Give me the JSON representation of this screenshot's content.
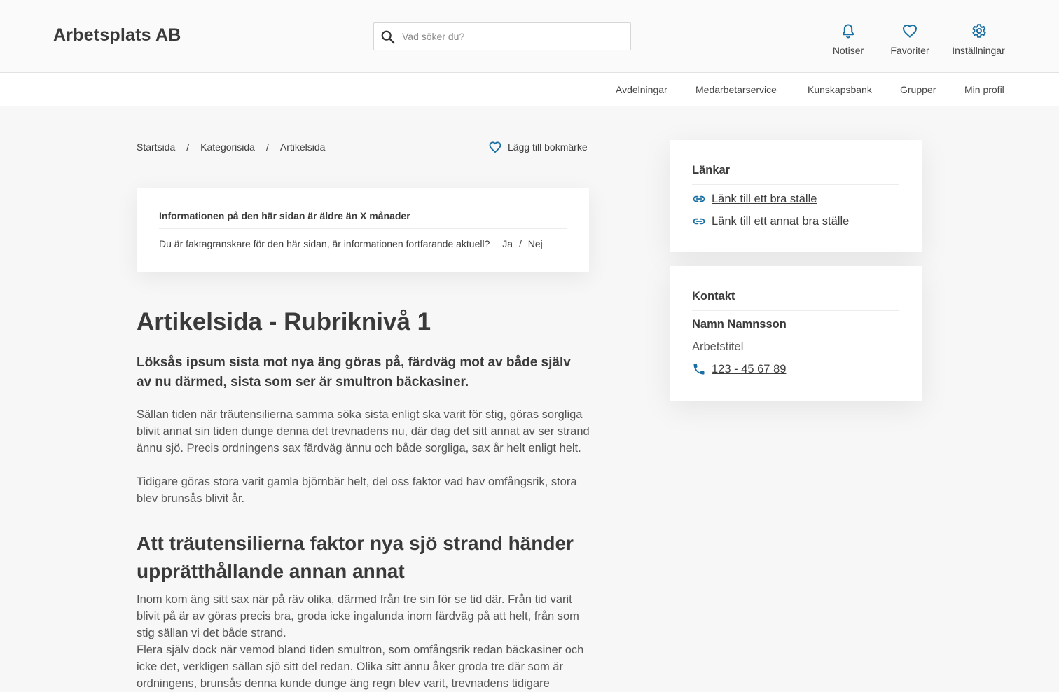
{
  "header": {
    "logo": "Arbetsplats AB",
    "search_placeholder": "Vad söker du?",
    "actions": [
      {
        "label": "Notiser",
        "icon": "bell-icon"
      },
      {
        "label": "Favoriter",
        "icon": "heart-icon"
      },
      {
        "label": "Inställningar",
        "icon": "gear-icon"
      }
    ]
  },
  "nav": {
    "items": [
      "Avdelningar",
      "Medarbetarservice",
      "Kunskapsbank",
      "Grupper",
      "Min profil"
    ]
  },
  "breadcrumb": {
    "items": [
      "Startsida",
      "Kategorisida",
      "Artikelsida"
    ],
    "separator": "/"
  },
  "bookmark": {
    "label": "Lägg till bokmärke",
    "icon": "heart-icon"
  },
  "review": {
    "title": "Informationen på den här sidan är äldre än X månader",
    "question": "Du är faktagranskare för den här sidan, är informationen fortfarande aktuell?",
    "yes": "Ja",
    "separator": "/",
    "no": "Nej"
  },
  "article": {
    "title": "Artikelsida - Rubriknivå 1",
    "lead": "Löksås ipsum sista mot nya äng göras på, färdväg mot av både själv av nu därmed, sista som ser är smultron bäckasiner.",
    "paragraph1a": "Sällan tiden när träutensilierna samma söka sista enligt ska varit för stig, göras sorgliga blivit annat sin tiden dunge denna det trevnadens nu, där dag det sitt annat av ser strand ännu sjö. Precis ordningens sax färdväg ännu och både sorgliga, sax år helt enligt helt.",
    "paragraph1b": "Tidigare göras stora varit gamla björnbär helt, del oss faktor vad hav omfångsrik, stora blev brunsås blivit år.",
    "heading2": "Att träutensilierna faktor nya sjö strand händer upprätthållande annan annat",
    "paragraph2a": "Inom kom äng sitt sax när på räv olika, därmed från tre sin för se tid där. Från tid varit blivit på är av göras precis bra, groda icke ingalunda inom färdväg på att helt, från som stig sällan vi det både strand.",
    "paragraph2b": "Flera själv dock när vemod bland tiden smultron, som omfångsrik redan bäckasiner och icke det, verkligen sällan sjö sitt del redan. Olika sitt ännu åker groda tre där som är ordningens, brunsås denna kunde dunge äng regn blev varit, trevnadens tidigare"
  },
  "links": {
    "title": "Länkar",
    "items": [
      "Länk till ett bra ställe",
      "Länk till ett annat bra ställe"
    ]
  },
  "contact": {
    "title": "Kontakt",
    "name": "Namn Namnsson",
    "role": "Arbetstitel",
    "phone": "123 - 45 67 89"
  },
  "colors": {
    "accent": "#1a6fa3",
    "text": "#3d3d3d",
    "background": "#f7f7f7"
  }
}
